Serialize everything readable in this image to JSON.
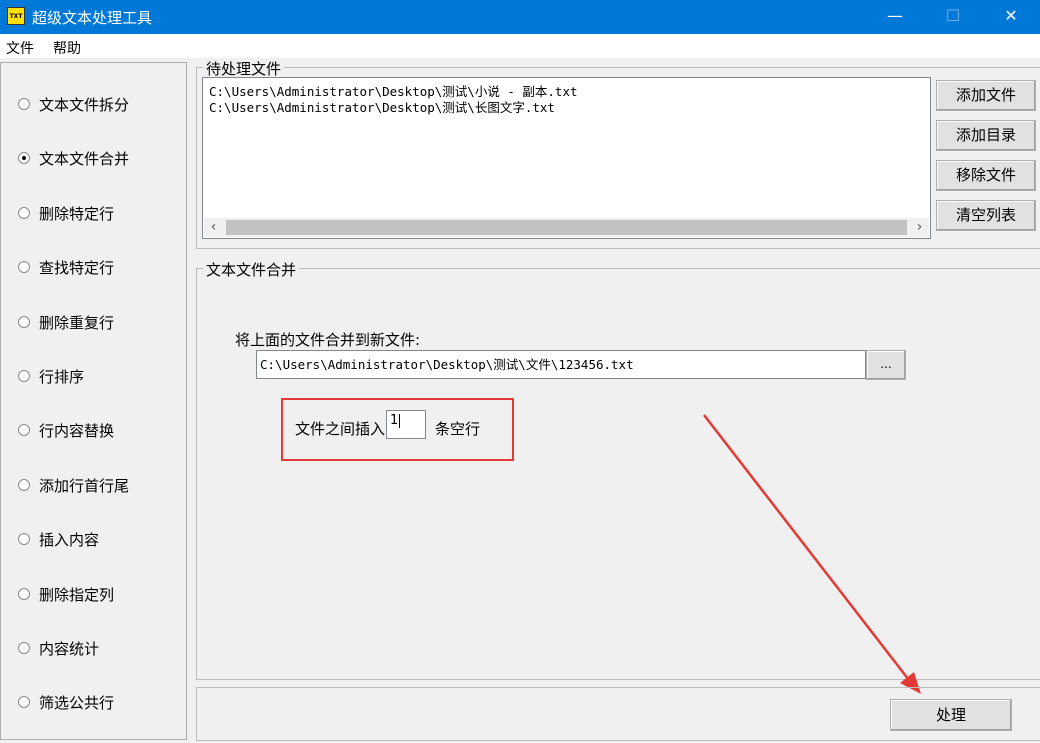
{
  "window": {
    "title": "超级文本处理工具",
    "icon_text": "TXT",
    "controls": {
      "minimize": "—",
      "maximize": "☐",
      "close": "✕"
    }
  },
  "menu": {
    "items": [
      "文件",
      "帮助"
    ]
  },
  "modes": {
    "selected_index": 1,
    "items": [
      "文本文件拆分",
      "文本文件合并",
      "删除特定行",
      "查找特定行",
      "删除重复行",
      "行排序",
      "行内容替换",
      "添加行首行尾",
      "插入内容",
      "删除指定列",
      "内容统计",
      "筛选公共行"
    ]
  },
  "pending_files": {
    "title": "待处理文件",
    "files": [
      "C:\\Users\\Administrator\\Desktop\\测试\\小说 - 副本.txt",
      "C:\\Users\\Administrator\\Desktop\\测试\\长图文字.txt"
    ],
    "buttons": {
      "add_file": "添加文件",
      "add_dir": "添加目录",
      "remove_file": "移除文件",
      "clear_list": "清空列表"
    }
  },
  "merge": {
    "title": "文本文件合并",
    "output_label": "将上面的文件合并到新文件:",
    "output_path": "C:\\Users\\Administrator\\Desktop\\测试\\文件\\123456.txt",
    "browse_label": "...",
    "insert_prefix": "文件之间插入",
    "insert_value": "1",
    "insert_suffix": "条空行"
  },
  "process_button": "处理",
  "annotation": {
    "color": "#e53935"
  }
}
